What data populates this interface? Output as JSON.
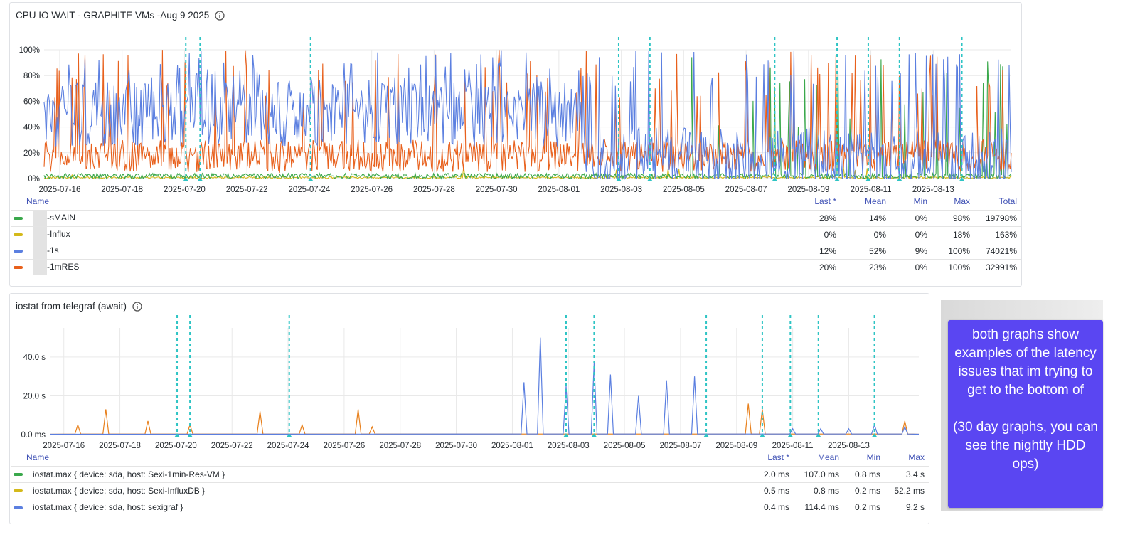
{
  "panel1": {
    "title": "CPU IO WAIT  - GRAPHITE VMs  -Aug 9 2025",
    "legend_headers": {
      "name": "Name",
      "last": "Last *",
      "mean": "Mean",
      "min": "Min",
      "max": "Max",
      "total": "Total"
    },
    "series": [
      {
        "name": "-sMAIN",
        "color": "#3aa84b",
        "last": "28%",
        "mean": "14%",
        "min": "0%",
        "max": "98%",
        "total": "19798%"
      },
      {
        "name": "-Influx",
        "color": "#d4b91a",
        "last": "0%",
        "mean": "0%",
        "min": "0%",
        "max": "18%",
        "total": "163%"
      },
      {
        "name": "-1s",
        "color": "#5b7fe0",
        "last": "12%",
        "mean": "52%",
        "min": "9%",
        "max": "100%",
        "total": "74021%"
      },
      {
        "name": "-1mRES",
        "color": "#e8601c",
        "last": "20%",
        "mean": "23%",
        "min": "0%",
        "max": "100%",
        "total": "32991%"
      }
    ]
  },
  "panel2": {
    "title": "iostat from telegraf (await)",
    "legend_headers": {
      "name": "Name",
      "last": "Last *",
      "mean": "Mean",
      "min": "Min",
      "max": "Max"
    },
    "series": [
      {
        "name": "iostat.max { device: sda, host: Sexi-1min-Res-VM }",
        "color": "#3aa84b",
        "last": "2.0 ms",
        "mean": "107.0 ms",
        "min": "0.8 ms",
        "max": "3.4 s"
      },
      {
        "name": "iostat.max { device: sda, host: Sexi-InfluxDB }",
        "color": "#d4b91a",
        "last": "0.5 ms",
        "mean": "0.8 ms",
        "min": "0.2 ms",
        "max": "52.2 ms"
      },
      {
        "name": "iostat.max { device: sda, host: sexigraf }",
        "color": "#5b7fe0",
        "last": "0.4 ms",
        "mean": "114.4 ms",
        "min": "0.2 ms",
        "max": "9.2 s"
      }
    ]
  },
  "note": {
    "text": "both graphs show examples of the latency issues that im trying to get to the bottom of\n\n(30 day graphs, you can see the nightly HDD ops)"
  },
  "chart_data": [
    {
      "type": "line",
      "title": "CPU IO WAIT  - GRAPHITE VMs  -Aug 9 2025",
      "x_ticks": [
        "2025-07-16",
        "2025-07-18",
        "2025-07-20",
        "2025-07-22",
        "2025-07-24",
        "2025-07-26",
        "2025-07-28",
        "2025-07-30",
        "2025-08-01",
        "2025-08-03",
        "2025-08-05",
        "2025-08-07",
        "2025-08-09",
        "2025-08-11",
        "2025-08-13"
      ],
      "y_ticks": [
        "0%",
        "20%",
        "40%",
        "60%",
        "80%",
        "100%"
      ],
      "ylim": [
        0,
        100
      ],
      "xlim": [
        "2025-07-15T12:00",
        "2025-08-15T12:00"
      ],
      "annotations_dates": [
        "2025-07-20T01:00",
        "2025-07-20T12:00",
        "2025-07-24T01:00",
        "2025-08-02T22:00",
        "2025-08-03T22:00",
        "2025-08-07T22:00",
        "2025-08-09T22:00",
        "2025-08-10T22:00",
        "2025-08-11T22:00",
        "2025-08-13T22:00"
      ],
      "series": [
        {
          "name": "-sMAIN",
          "color": "#3aa84b",
          "stats": {
            "last": 28,
            "mean": 14,
            "min": 0,
            "max": 98
          }
        },
        {
          "name": "-Influx",
          "color": "#d4b91a",
          "stats": {
            "last": 0,
            "mean": 0,
            "min": 0,
            "max": 18
          }
        },
        {
          "name": "-1s",
          "color": "#5b7fe0",
          "stats": {
            "last": 12,
            "mean": 52,
            "min": 9,
            "max": 100
          }
        },
        {
          "name": "-1mRES",
          "color": "#e8601c",
          "stats": {
            "last": 20,
            "mean": 23,
            "min": 0,
            "max": 100
          }
        }
      ],
      "grid": true,
      "legend": "bottom"
    },
    {
      "type": "line",
      "title": "iostat from telegraf (await)",
      "x_ticks": [
        "2025-07-16",
        "2025-07-18",
        "2025-07-20",
        "2025-07-22",
        "2025-07-24",
        "2025-07-26",
        "2025-07-28",
        "2025-07-30",
        "2025-08-01",
        "2025-08-03",
        "2025-08-05",
        "2025-08-07",
        "2025-08-09",
        "2025-08-11",
        "2025-08-13"
      ],
      "y_ticks": [
        "0.0 ms",
        "20.0 s",
        "40.0 s"
      ],
      "ylim": [
        0,
        55
      ],
      "xlim": [
        "2025-07-15T12:00",
        "2025-08-15T12:00"
      ],
      "annotations_dates": [
        "2025-07-20T01:00",
        "2025-07-20T12:00",
        "2025-07-24T01:00",
        "2025-08-02T22:00",
        "2025-08-03T22:00",
        "2025-08-07T22:00",
        "2025-08-09T22:00",
        "2025-08-10T22:00",
        "2025-08-11T22:00",
        "2025-08-13T22:00"
      ],
      "series": [
        {
          "name": "iostat.max { device: sda, host: Sexi-1min-Res-VM }",
          "color": "#3aa84b",
          "peaks": []
        },
        {
          "name": "iostat.max { device: sda, host: Sexi-InfluxDB }",
          "color": "#e8801c",
          "peaks": [
            [
              "2025-07-16T12:00",
              5
            ],
            [
              "2025-07-17T12:00",
              13
            ],
            [
              "2025-07-19T00:00",
              7
            ],
            [
              "2025-07-20T12:00",
              5
            ],
            [
              "2025-07-23T00:00",
              12
            ],
            [
              "2025-07-24T12:00",
              5
            ],
            [
              "2025-07-26T12:00",
              13
            ],
            [
              "2025-07-27T00:00",
              4
            ],
            [
              "2025-08-09T10:00",
              16
            ],
            [
              "2025-08-09T22:00",
              13
            ],
            [
              "2025-08-15T00:00",
              7
            ]
          ]
        },
        {
          "name": "iostat.max { device: sda, host: sexigraf }",
          "color": "#5b7fe0",
          "peaks": [
            [
              "2025-08-01T10:00",
              27
            ],
            [
              "2025-08-02T00:00",
              50
            ],
            [
              "2025-08-02T22:00",
              25
            ],
            [
              "2025-08-03T22:00",
              37
            ],
            [
              "2025-08-04T12:00",
              31
            ],
            [
              "2025-08-05T12:00",
              20
            ],
            [
              "2025-08-06T12:00",
              28
            ],
            [
              "2025-08-07T12:00",
              30
            ],
            [
              "2025-08-11T00:00",
              3
            ],
            [
              "2025-08-12T00:00",
              3
            ],
            [
              "2025-08-13T00:00",
              3
            ],
            [
              "2025-08-13T22:00",
              5
            ],
            [
              "2025-08-15T00:00",
              4
            ]
          ]
        }
      ],
      "grid": true,
      "legend": "bottom"
    }
  ]
}
